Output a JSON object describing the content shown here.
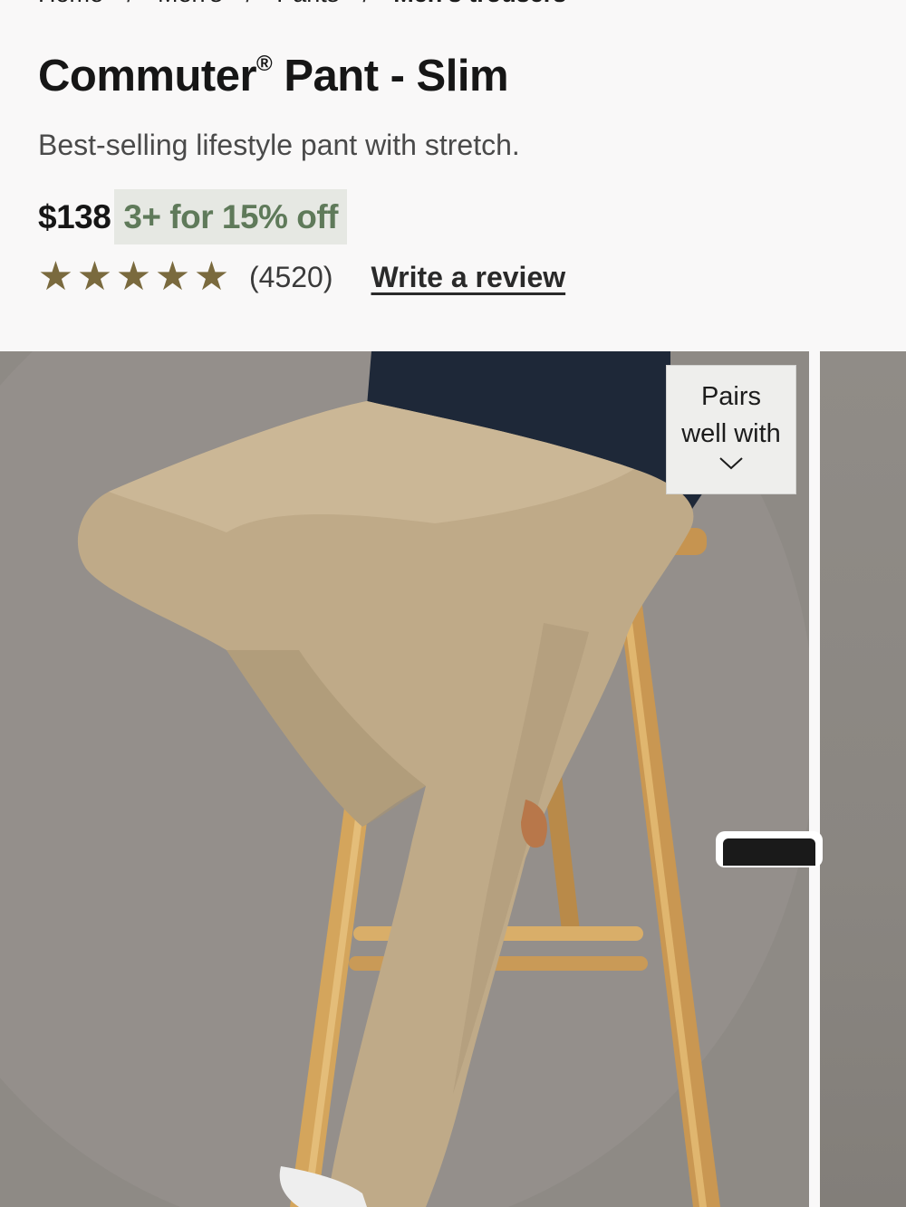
{
  "breadcrumb": {
    "items": [
      "Home",
      "Men's",
      "Pants",
      "Men's trousers"
    ],
    "separator": "/"
  },
  "product": {
    "title": "Commuter",
    "title_mark": "®",
    "title_suffix": " Pant - Slim",
    "subtitle": "Best-selling lifestyle pant with stretch.",
    "price": "$138",
    "promo": "3+ for 15% off",
    "rating": 4.8,
    "review_count": "(4520)",
    "write_review": "Write a review"
  },
  "gallery": {
    "pairs_label_line1": "Pairs",
    "pairs_label_line2": "well with"
  },
  "colors": {
    "promo_bg": "#e6e8e3",
    "promo_text": "#5f7a5a",
    "star": "#7a6a3e",
    "pant": "#c2ae8c",
    "stool": "#d4a55c",
    "sweater": "#1e2838"
  }
}
